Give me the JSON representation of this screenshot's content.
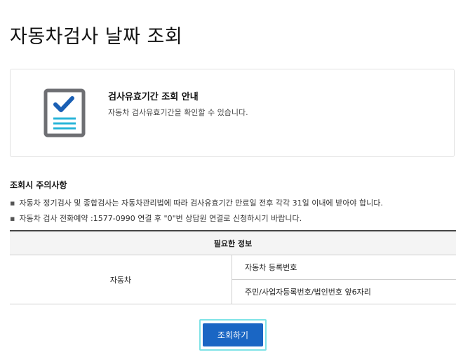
{
  "page": {
    "title": "자동차검사 날짜 조회"
  },
  "info": {
    "icon": "checklist-document-icon",
    "title": "검사유효기간 조회 안내",
    "description": "자동차 검사유효기간을 확인할 수 있습니다."
  },
  "notes": {
    "heading": "조회시 주의사항",
    "items": [
      "자동차 정기검사 및 종합검사는 자동차관리법에 따라 검사유효기간 만료일 전후 각각 31일 이내에 받아야 합니다.",
      "자동차 검사 전화예약 :1577-0990 연결 후 \"0\"번 상담원 연결로 신청하시기 바랍니다."
    ]
  },
  "table": {
    "header": "필요한 정보",
    "category": "자동차",
    "items": [
      "자동차 등록번호",
      "주민/사업자등록번호/법인번호 앞6자리"
    ]
  },
  "actions": {
    "submit_label": "조회하기"
  },
  "colors": {
    "primary_button": "#1a66c4",
    "focus_ring": "#7fe3e6",
    "icon_check": "#1a5fb4",
    "icon_lines": "#2ab5d8"
  }
}
